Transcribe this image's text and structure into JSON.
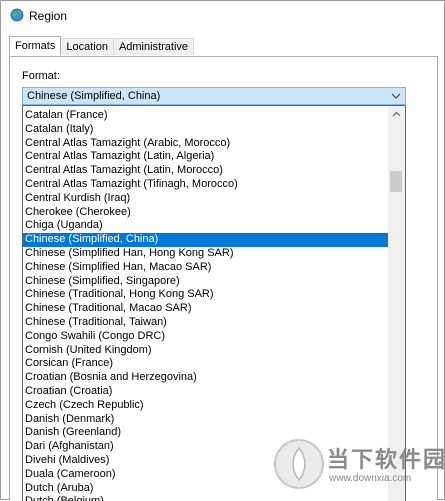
{
  "window": {
    "title": "Region"
  },
  "tabs": [
    {
      "label": "Formats",
      "active": true
    },
    {
      "label": "Location",
      "active": false
    },
    {
      "label": "Administrative",
      "active": false
    }
  ],
  "format": {
    "label": "Format:",
    "selected_value": "Chinese (Simplified, China)"
  },
  "dropdown": {
    "items": [
      "Catalan (France)",
      "Catalan (Italy)",
      "Central Atlas Tamazight (Arabic, Morocco)",
      "Central Atlas Tamazight (Latin, Algeria)",
      "Central Atlas Tamazight (Latin, Morocco)",
      "Central Atlas Tamazight (Tifinagh, Morocco)",
      "Central Kurdish (Iraq)",
      "Cherokee (Cherokee)",
      "Chiga (Uganda)",
      "Chinese (Simplified, China)",
      "Chinese (Simplified Han, Hong Kong SAR)",
      "Chinese (Simplified Han, Macao SAR)",
      "Chinese (Simplified, Singapore)",
      "Chinese (Traditional, Hong Kong SAR)",
      "Chinese (Traditional, Macao SAR)",
      "Chinese (Traditional, Taiwan)",
      "Congo Swahili (Congo DRC)",
      "Cornish (United Kingdom)",
      "Corsican (France)",
      "Croatian (Bosnia and Herzegovina)",
      "Croatian (Croatia)",
      "Czech (Czech Republic)",
      "Danish (Denmark)",
      "Danish (Greenland)",
      "Dari (Afghanistan)",
      "Divehi (Maldives)",
      "Duala (Cameroon)",
      "Dutch (Aruba)",
      "Dutch (Belgium)"
    ],
    "selected_index": 9
  },
  "watermark": {
    "text": "当下软件园",
    "url": "www.downxia.com"
  },
  "colors": {
    "selection": "#0078d7",
    "combo_bg": "#cce4f7",
    "combo_border": "#7eb4ea"
  },
  "icons": {
    "title": "globe-icon",
    "combo": "chevron-down-icon",
    "scroll_up": "chevron-up-icon"
  }
}
